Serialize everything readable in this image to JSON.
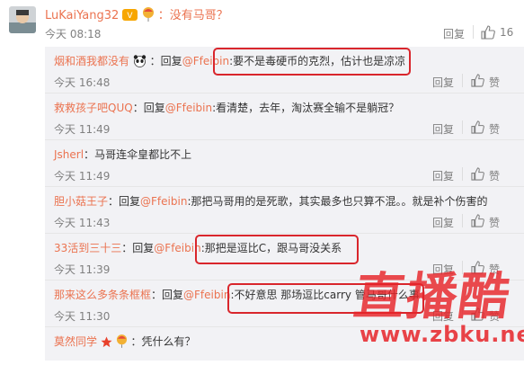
{
  "main_comment": {
    "user": "LuKaiYang32",
    "separator": "：",
    "text": "没有马哥？",
    "time": "今天 08:18",
    "reply_label": "回复",
    "likes": "16"
  },
  "replies": [
    {
      "user": "烟和酒我都没有",
      "before": "：回复",
      "mention": "@Ffeibin",
      "text": ":要不是毒硬币的克烈，估计也是凉凉",
      "time": "今天 16:48",
      "reply_label": "回复",
      "like_label": "赞"
    },
    {
      "user": "救救孩子吧QUQ",
      "before": "：回复",
      "mention": "@Ffeibin",
      "text": ":看清楚，去年，淘汰赛全输不是躺冠？",
      "time": "今天 11:49",
      "reply_label": "回复",
      "like_label": "赞"
    },
    {
      "user": "Jsherl",
      "before": "：",
      "mention": "",
      "text": "马哥连伞皇都比不上",
      "time": "今天 11:49",
      "reply_label": "回复",
      "like_label": "赞"
    },
    {
      "user": "胆小菇王子",
      "before": "：回复",
      "mention": "@Ffeibin",
      "text": ":那把马哥用的是死歌，其实最多也只算不混。。就是补个伤害的",
      "time": "今天 11:43",
      "reply_label": "回复",
      "like_label": "赞"
    },
    {
      "user": "33活到三十三",
      "before": "：回复",
      "mention": "@Ffeibin",
      "text": ":那把是逗比C，跟马哥没关系",
      "time": "今天 11:39",
      "reply_label": "回复",
      "like_label": "赞"
    },
    {
      "user": "那来这么多条条框框",
      "before": "：回复",
      "mention": "@Ffeibin",
      "text": ":不好意思 那场逗比carry 管马哥什么事",
      "time": "今天 11:30",
      "reply_label": "回复",
      "like_label": "赞"
    },
    {
      "user": "莫然同学",
      "before": "：",
      "mention": "",
      "text": "凭什么有？",
      "time": "",
      "reply_label": "",
      "like_label": ""
    }
  ],
  "watermark": {
    "text": "直播酷",
    "url": "www.zbku.net"
  },
  "icons": {
    "like": "thumbs-up-icon",
    "avatar": "avatar-icon",
    "vip": "vip-badge-icon",
    "balloon": "balloon-icon",
    "panda": "panda-emoji-icon",
    "star": "star-icon"
  },
  "colors": {
    "username": "#eb7350",
    "highlight": "#d9262c",
    "panel": "#f2f2f5"
  }
}
